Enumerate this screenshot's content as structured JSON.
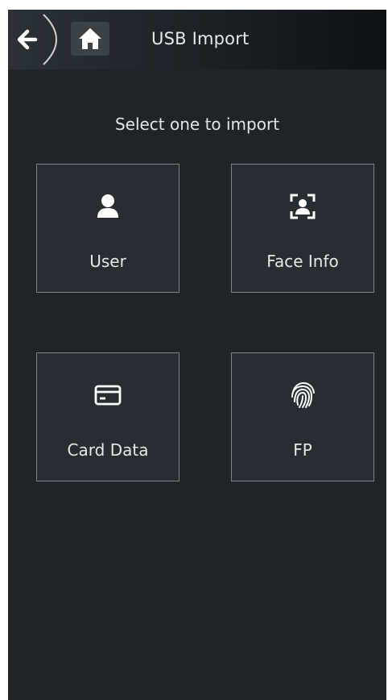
{
  "header": {
    "title": "USB Import",
    "back_icon": "back-arrow-icon",
    "home_icon": "home-icon"
  },
  "main": {
    "prompt": "Select one to import",
    "options": [
      {
        "label": "User",
        "icon": "user-icon"
      },
      {
        "label": "Face Info",
        "icon": "face-icon"
      },
      {
        "label": "Card Data",
        "icon": "card-icon"
      },
      {
        "label": "FP",
        "icon": "fingerprint-icon"
      }
    ]
  },
  "colors": {
    "background": "#1f2429",
    "tile_background": "#272d32",
    "tile_border": "#7d8389",
    "text": "#e6e8ea"
  }
}
